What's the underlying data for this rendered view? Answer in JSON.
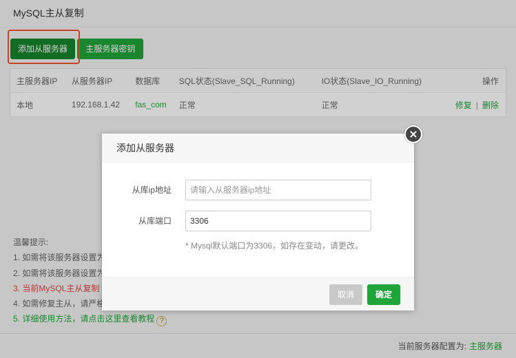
{
  "panel": {
    "title": "MySQL主从复制",
    "toolbar": {
      "add_slave_label": "添加从服务器",
      "master_key_label": "主服务器密钥"
    },
    "table": {
      "headers": [
        "主服务器IP",
        "从服务器IP",
        "数据库",
        "SQL状态(Slave_SQL_Running)",
        "IO状态(Slave_IO_Running)",
        "操作"
      ],
      "rows": [
        {
          "master_ip": "本地",
          "slave_ip": "192.168.1.42",
          "database": "fas_com",
          "sql_status": "正常",
          "io_status": "正常",
          "action_repair": "修复",
          "action_separator": "|",
          "action_delete": "删除"
        }
      ]
    },
    "tips": {
      "title": "温馨提示:",
      "items": [
        "1. 如需将该服务器设置为",
        "2. 如需将该服务器设置为",
        "3. 当前MySQL主从复制",
        "4. 如需修复主从，请严格",
        "5. 详细使用方法，请点击这里查看教程"
      ],
      "help_icon_glyph": "?"
    },
    "footer": {
      "label": "当前服务器配置为:",
      "value": "主服务器"
    }
  },
  "modal": {
    "title": "添加从服务器",
    "fields": {
      "slave_ip": {
        "label": "从库ip地址",
        "placeholder": "请输入从服务器ip地址",
        "value": ""
      },
      "slave_port": {
        "label": "从库端口",
        "value": "3306"
      }
    },
    "hint": "* Mysql默认端口为3306，如存在变动，请更改。",
    "cancel_label": "取消",
    "confirm_label": "确定"
  },
  "colors": {
    "accent": "#20a53a",
    "highlight_border": "#f2532d",
    "warning_text": "#e24444"
  }
}
